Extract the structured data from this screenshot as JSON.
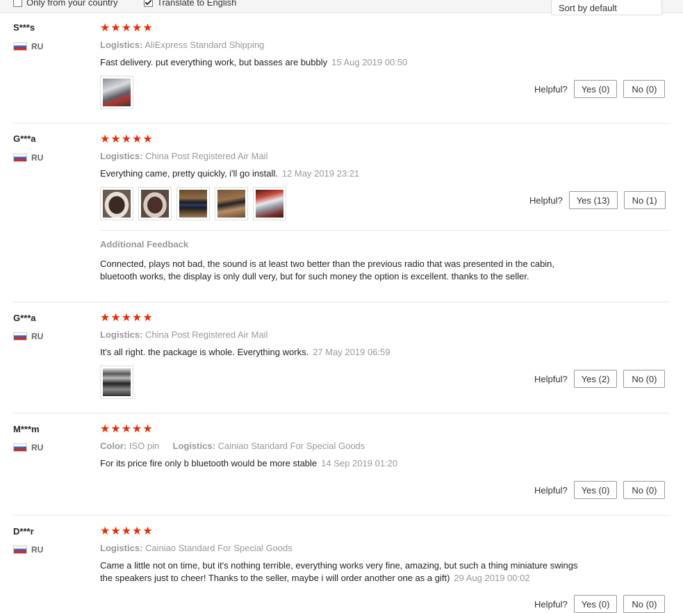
{
  "filters": {
    "only_country": "Only from your country",
    "translate": "Translate to English",
    "sort": "Sort by default"
  },
  "helpful_label": "Helpful?",
  "reviews": [
    {
      "user": "S***s",
      "country": "RU",
      "stars": 5,
      "meta": {
        "logistics_label": "Logistics:",
        "logistics": "AliExpress Standard Shipping"
      },
      "text": "Fast delivery. put everything work, but basses are bubbly",
      "date": "15 Aug 2019 00:50",
      "yes": "Yes (0)",
      "no": "No (0)"
    },
    {
      "user": "G***a",
      "country": "RU",
      "stars": 5,
      "meta": {
        "logistics_label": "Logistics:",
        "logistics": "China Post Registered Air Mail"
      },
      "text": "Everything came, pretty quickly, i'll go install.",
      "date": "12 May 2019 23:21",
      "yes": "Yes (13)",
      "no": "No (1)",
      "additional_title": "Additional Feedback",
      "additional_text": "Connected, plays not bad, the sound is at least two better than the previous radio that was presented in the cabin, bluetooth works, the display is only dull very, but for such money the option is excellent. thanks to the seller."
    },
    {
      "user": "G***a",
      "country": "RU",
      "stars": 5,
      "meta": {
        "logistics_label": "Logistics:",
        "logistics": "China Post Registered Air Mail"
      },
      "text": "It's all right. the package is whole. Everything works.",
      "date": "27 May 2019 06:59",
      "yes": "Yes (2)",
      "no": "No (0)"
    },
    {
      "user": "M***m",
      "country": "RU",
      "stars": 5,
      "meta": {
        "color_label": "Color:",
        "color": "ISO pin",
        "logistics_label": "Logistics:",
        "logistics": "Cainiao Standard For Special Goods"
      },
      "text": "For its price fire only b bluetooth would be more stable",
      "date": "14 Sep 2019 01:20",
      "yes": "Yes (0)",
      "no": "No (0)"
    },
    {
      "user": "D***r",
      "country": "RU",
      "stars": 5,
      "meta": {
        "logistics_label": "Logistics:",
        "logistics": "Cainiao Standard For Special Goods"
      },
      "text": "Came a little not on time, but it's nothing terrible, everything works very fine, amazing, but such a thing miniature swings the speakers just to cheer! Thanks to the seller, maybe i will order another one as a gift)",
      "date": "29 Aug 2019 00:02",
      "yes": "Yes (0)",
      "no": "No (0)"
    }
  ],
  "star_glyph": "★",
  "colors": {
    "star": "#e62e04"
  }
}
